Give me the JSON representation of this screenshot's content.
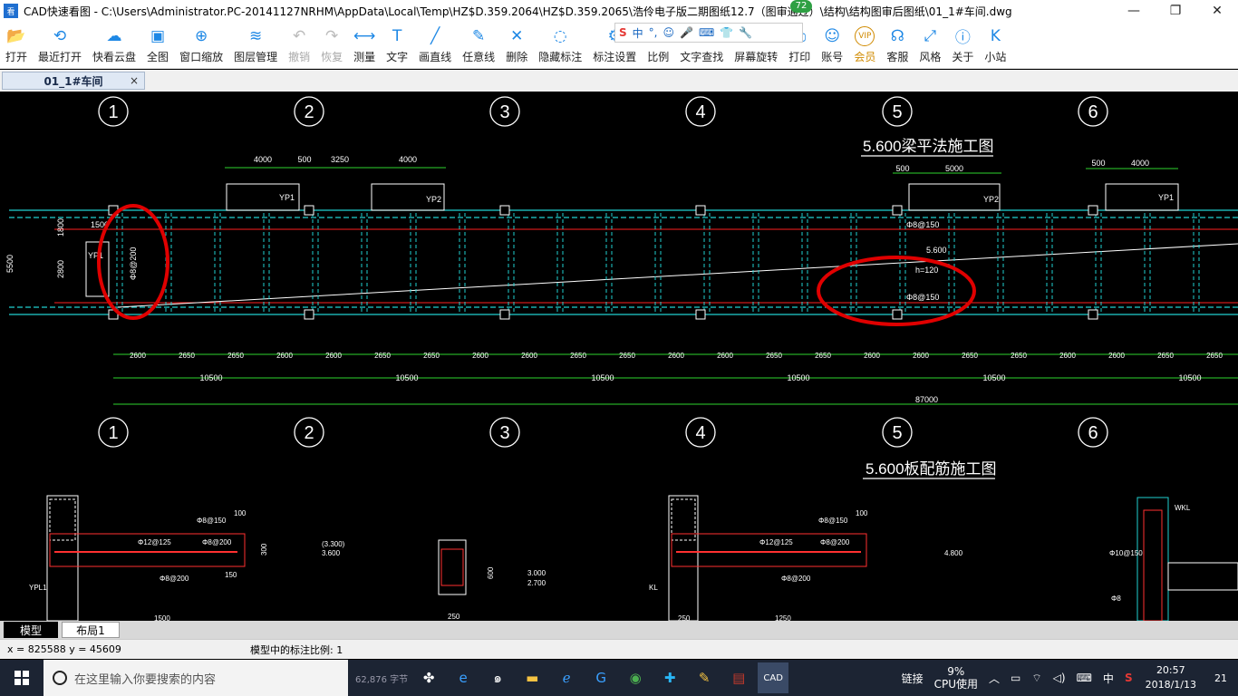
{
  "window": {
    "title": "CAD快速看图 - C:\\Users\\Administrator.PC-20141127NRHM\\AppData\\Local\\Temp\\HZ$D.359.2064\\HZ$D.359.2065\\浩伶电子版二期图纸12.7（图审通过）\\结构\\结构图审后图纸\\01_1#车间.dwg",
    "badge": "72"
  },
  "toolbar": [
    {
      "label": "打开",
      "icon": "folder-icon",
      "glyph": "📂"
    },
    {
      "label": "最近打开",
      "icon": "history-icon",
      "glyph": "⟲"
    },
    {
      "label": "快看云盘",
      "icon": "cloud-icon",
      "glyph": "☁"
    },
    {
      "label": "全图",
      "icon": "fullview-icon",
      "glyph": "▣"
    },
    {
      "label": "窗口缩放",
      "icon": "zoom-window-icon",
      "glyph": "⊕"
    },
    {
      "label": "图层管理",
      "icon": "layers-icon",
      "glyph": "≋"
    },
    {
      "label": "撤销",
      "icon": "undo-icon",
      "glyph": "↶",
      "disabled": true
    },
    {
      "label": "恢复",
      "icon": "redo-icon",
      "glyph": "↷",
      "disabled": true
    },
    {
      "label": "测量",
      "icon": "measure-icon",
      "glyph": "⟷"
    },
    {
      "label": "文字",
      "icon": "text-icon",
      "glyph": "T"
    },
    {
      "label": "画直线",
      "icon": "line-icon",
      "glyph": "╱"
    },
    {
      "label": "任意线",
      "icon": "pen-icon",
      "glyph": "✎"
    },
    {
      "label": "删除",
      "icon": "delete-icon",
      "glyph": "✕"
    },
    {
      "label": "隐藏标注",
      "icon": "hide-icon",
      "glyph": "◌"
    },
    {
      "label": "标注设置",
      "icon": "settings-icon",
      "glyph": "⚙"
    },
    {
      "label": "比例",
      "icon": "scale-icon",
      "glyph": "%"
    },
    {
      "label": "文字查找",
      "icon": "text-search-icon",
      "glyph": "⌕"
    },
    {
      "label": "屏幕旋转",
      "icon": "rotate-icon",
      "glyph": "⟳"
    },
    {
      "label": "打印",
      "icon": "print-icon",
      "glyph": "⎙"
    },
    {
      "label": "账号",
      "icon": "user-icon",
      "glyph": "☺"
    },
    {
      "label": "会员",
      "icon": "vip-icon",
      "glyph": "VIP",
      "vip": true
    },
    {
      "label": "客服",
      "icon": "headset-icon",
      "glyph": "☊"
    },
    {
      "label": "风格",
      "icon": "style-icon",
      "glyph": "⤢"
    },
    {
      "label": "关于",
      "icon": "info-icon",
      "glyph": "ⓘ"
    },
    {
      "label": "小站",
      "icon": "site-icon",
      "glyph": "K"
    }
  ],
  "ime": {
    "logo": "S",
    "mode": "中",
    "punct": "°,"
  },
  "tabs": {
    "doc": "01_1#车间",
    "close": "×"
  },
  "drawing": {
    "axes": [
      "1",
      "2",
      "3",
      "4",
      "5",
      "6"
    ],
    "title1": "5.600梁平法施工图",
    "title2": "5.600板配筋施工图",
    "dims_top": [
      "4000",
      "500",
      "3250",
      "4000",
      "500",
      "5000",
      "500",
      "4000"
    ],
    "dims_bays": [
      "2600",
      "2650",
      "2650",
      "2600",
      "2600",
      "2650",
      "2650",
      "2600",
      "2600",
      "2650",
      "2650",
      "2600",
      "2600",
      "2650",
      "2650",
      "2600",
      "2600",
      "2650",
      "2650",
      "2600",
      "2600",
      "2650",
      "2650"
    ],
    "dims_spans": [
      "10500",
      "10500",
      "10500",
      "10500",
      "10500",
      "10500"
    ],
    "dim_total": "87000",
    "labels": {
      "yp1": "YP1",
      "yp2": "YP2",
      "yp1_left": "YP1",
      "rebar150": "Φ8@150",
      "rebar200": "Φ8@200",
      "elev": "5.600",
      "thk": "h=120",
      "d1500": "1500",
      "d1800": "1800",
      "d2800": "2800",
      "d5500": "5500"
    },
    "sections": {
      "s1": {
        "t1": "Φ8@150",
        "t2": "Φ12@125",
        "t3": "Φ8@200",
        "t4": "Φ8@200",
        "elev": "(3.300)",
        "elev2": "3.600",
        "name": "YPL1",
        "w": "1500",
        "d100": "100",
        "d300": "300",
        "d150": "150"
      },
      "s2": {
        "e1": "3.000",
        "e2": "2.700",
        "w": "250",
        "d600": "600"
      },
      "s3": {
        "t1": "Φ8@150",
        "t2": "Φ12@125",
        "t3": "Φ8@200",
        "t4": "Φ8@200",
        "elev": "4.800",
        "name": "KL",
        "w": "1250",
        "w2": "250",
        "d100": "100"
      },
      "s4": {
        "t1": "Φ10@150",
        "t2": "Φ8",
        "t3": "WKL"
      }
    }
  },
  "layout_tabs": {
    "model": "模型",
    "layout1": "布局1"
  },
  "status": {
    "coords": "x = 825588  y = 45609",
    "scale": "模型中的标注比例: 1"
  },
  "taskbar": {
    "search_placeholder": "在这里输入你要搜索的内容",
    "hidden_text": "62,876 字节",
    "tray_link": "链接",
    "cpu_pct": "9%",
    "cpu_label": "CPU使用",
    "ime": "中",
    "time": "20:57",
    "date": "2018/1/13",
    "notif": "21"
  }
}
